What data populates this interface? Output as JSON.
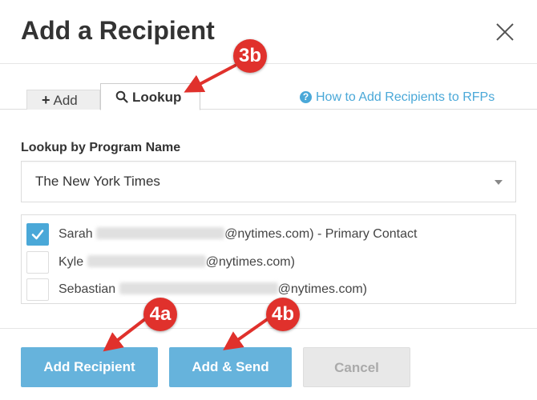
{
  "modal": {
    "title": "Add a Recipient"
  },
  "tabs": {
    "add_plus": "+",
    "add_label": "Add",
    "lookup_label": "Lookup",
    "help_icon": "?",
    "help_link": "How to Add Recipients to RFPs"
  },
  "lookup": {
    "label": "Lookup by Program Name",
    "selected_program": "The New York Times"
  },
  "recipients": [
    {
      "name": "Sarah",
      "suffix": "@nytimes.com) - Primary Contact",
      "checked": true
    },
    {
      "name": "Kyle",
      "suffix": "@nytimes.com)",
      "checked": false
    },
    {
      "name": "Sebastian",
      "suffix": "@nytimes.com)",
      "checked": false
    }
  ],
  "footer": {
    "add_recipient": "Add Recipient",
    "add_send": "Add & Send",
    "cancel": "Cancel"
  },
  "annotations": {
    "step_3b": "3b",
    "step_4a": "4a",
    "step_4b": "4b"
  },
  "colors": {
    "accent": "#4aa8d8",
    "primary_button": "#66b3dc",
    "callout": "#e0312c"
  },
  "icons": {
    "close": "close-icon",
    "search": "search-icon",
    "help": "help-circle-icon",
    "check": "checkmark-icon",
    "caret": "caret-down-icon"
  }
}
